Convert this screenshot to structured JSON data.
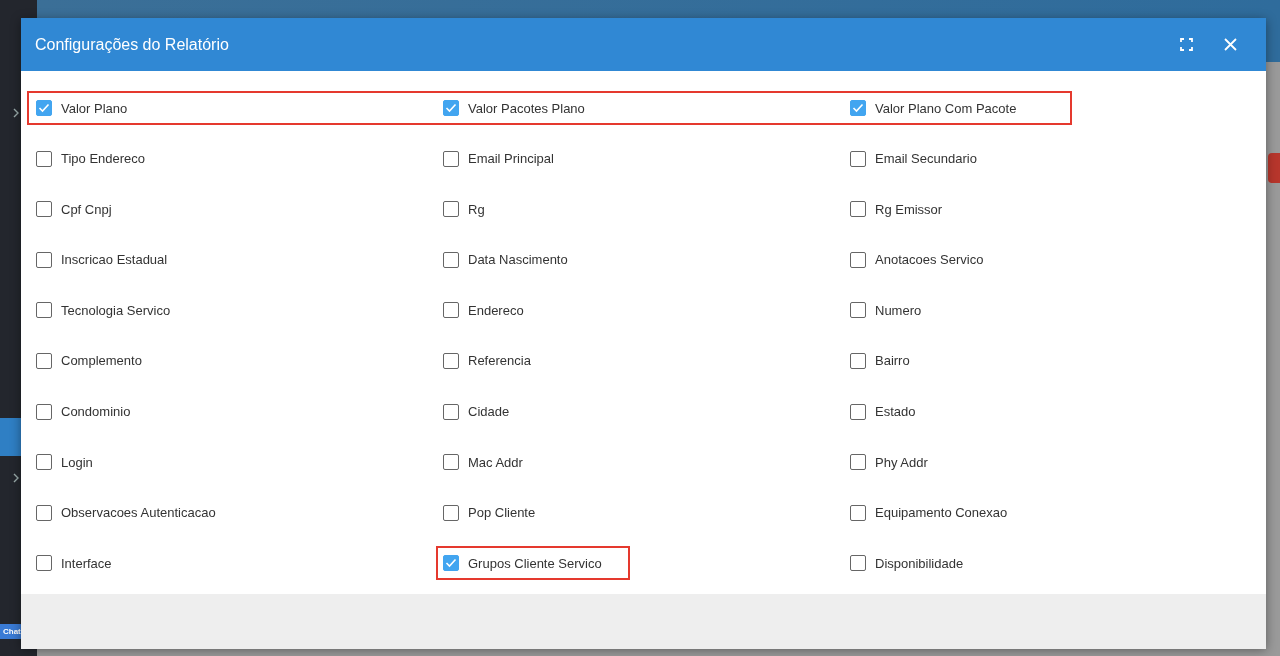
{
  "page": {
    "chat": "Chat"
  },
  "dialog": {
    "title": "Configurações do Relatório",
    "rows": [
      {
        "highlighted": true,
        "items": [
          {
            "label": "Valor Plano",
            "checked": true,
            "highlighted": false
          },
          {
            "label": "Valor Pacotes Plano",
            "checked": true,
            "highlighted": false
          },
          {
            "label": "Valor Plano Com Pacote",
            "checked": true,
            "highlighted": false
          }
        ]
      },
      {
        "highlighted": false,
        "items": [
          {
            "label": "Tipo Endereco",
            "checked": false,
            "highlighted": false
          },
          {
            "label": "Email Principal",
            "checked": false,
            "highlighted": false
          },
          {
            "label": "Email Secundario",
            "checked": false,
            "highlighted": false
          }
        ]
      },
      {
        "highlighted": false,
        "items": [
          {
            "label": "Cpf Cnpj",
            "checked": false,
            "highlighted": false
          },
          {
            "label": "Rg",
            "checked": false,
            "highlighted": false
          },
          {
            "label": "Rg Emissor",
            "checked": false,
            "highlighted": false
          }
        ]
      },
      {
        "highlighted": false,
        "items": [
          {
            "label": "Inscricao Estadual",
            "checked": false,
            "highlighted": false
          },
          {
            "label": "Data Nascimento",
            "checked": false,
            "highlighted": false
          },
          {
            "label": "Anotacoes Servico",
            "checked": false,
            "highlighted": false
          }
        ]
      },
      {
        "highlighted": false,
        "items": [
          {
            "label": "Tecnologia Servico",
            "checked": false,
            "highlighted": false
          },
          {
            "label": "Endereco",
            "checked": false,
            "highlighted": false
          },
          {
            "label": "Numero",
            "checked": false,
            "highlighted": false
          }
        ]
      },
      {
        "highlighted": false,
        "items": [
          {
            "label": "Complemento",
            "checked": false,
            "highlighted": false
          },
          {
            "label": "Referencia",
            "checked": false,
            "highlighted": false
          },
          {
            "label": "Bairro",
            "checked": false,
            "highlighted": false
          }
        ]
      },
      {
        "highlighted": false,
        "items": [
          {
            "label": "Condominio",
            "checked": false,
            "highlighted": false
          },
          {
            "label": "Cidade",
            "checked": false,
            "highlighted": false
          },
          {
            "label": "Estado",
            "checked": false,
            "highlighted": false
          }
        ]
      },
      {
        "highlighted": false,
        "items": [
          {
            "label": "Login",
            "checked": false,
            "highlighted": false
          },
          {
            "label": "Mac Addr",
            "checked": false,
            "highlighted": false
          },
          {
            "label": "Phy Addr",
            "checked": false,
            "highlighted": false
          }
        ]
      },
      {
        "highlighted": false,
        "items": [
          {
            "label": "Observacoes Autenticacao",
            "checked": false,
            "highlighted": false
          },
          {
            "label": "Pop Cliente",
            "checked": false,
            "highlighted": false
          },
          {
            "label": "Equipamento Conexao",
            "checked": false,
            "highlighted": false
          }
        ]
      },
      {
        "highlighted": false,
        "items": [
          {
            "label": "Interface",
            "checked": false,
            "highlighted": false
          },
          {
            "label": "Grupos Cliente Servico",
            "checked": true,
            "highlighted": true
          },
          {
            "label": "Disponibilidade",
            "checked": false,
            "highlighted": false
          }
        ]
      }
    ]
  }
}
